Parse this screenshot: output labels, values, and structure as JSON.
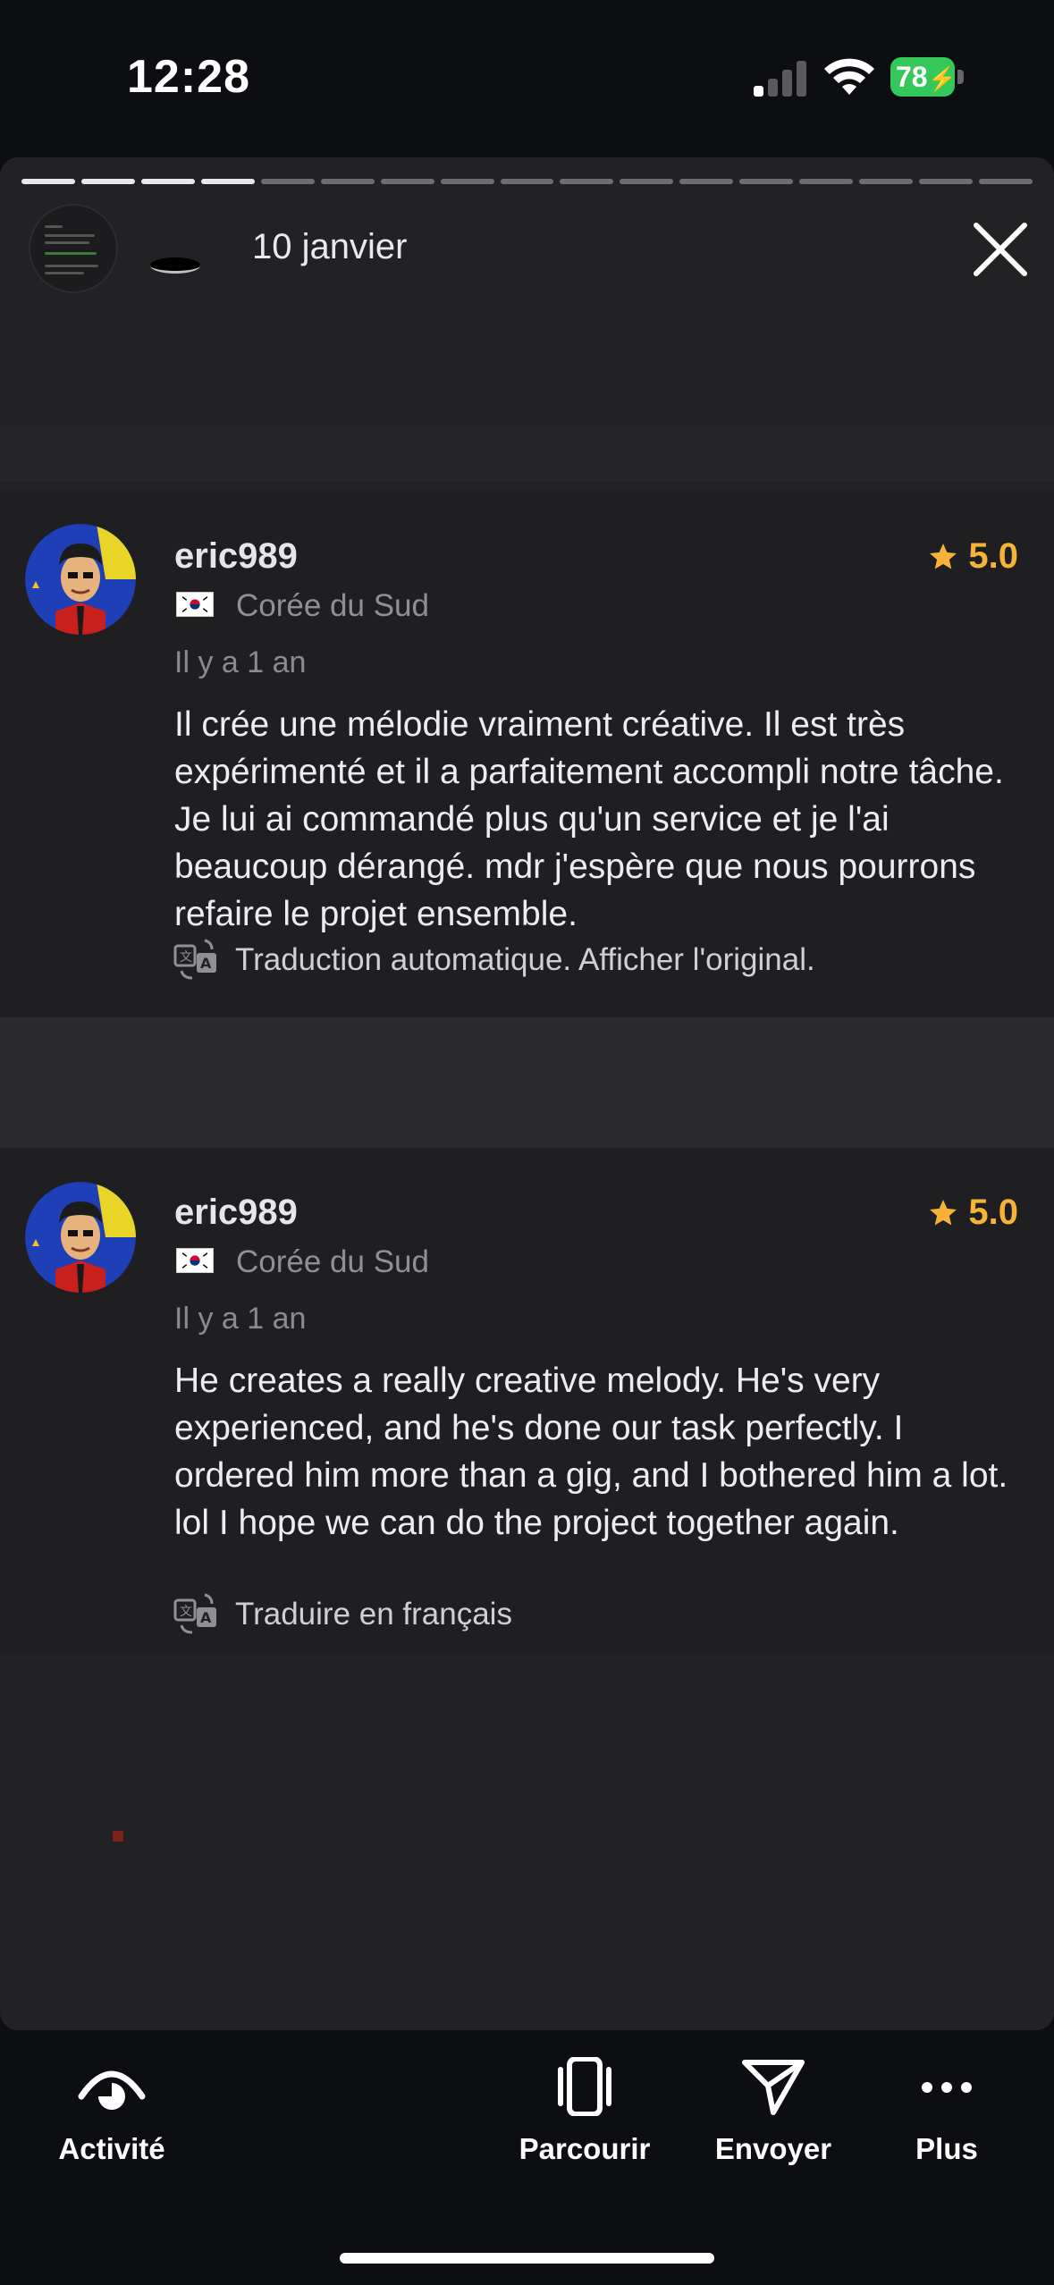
{
  "status": {
    "time": "12:28",
    "battery": "78",
    "battery_color": "#34c759"
  },
  "story": {
    "date": "10 janvier",
    "segments_total": 17,
    "segments_done": 4
  },
  "reviews": [
    {
      "username": "eric989",
      "rating": "5.0",
      "country": "Corée du Sud",
      "ago": "Il y a 1 an",
      "text": "Il crée une mélodie vraiment créative. Il est très expérimenté et il a parfaitement accompli notre tâche. Je lui ai commandé plus qu'un service et je l'ai beaucoup dérangé. mdr j'espère que nous pourrons refaire le projet ensemble.",
      "translate_label": "Traduction automatique. Afficher l'original."
    },
    {
      "username": "eric989",
      "rating": "5.0",
      "country": "Corée du Sud",
      "ago": "Il y a 1 an",
      "text": "He creates a really creative melody. He's very experienced, and he's done our task perfectly. I ordered him more than a gig, and I bothered him a lot. lol I hope we can do the project together again.",
      "translate_label": "Traduire en français"
    }
  ],
  "bottom_bar": {
    "activity": "Activité",
    "browse": "Parcourir",
    "send": "Envoyer",
    "more": "Plus"
  },
  "colors": {
    "rating": "#f7b338",
    "background": "#0d0e12",
    "panel": "#222224"
  }
}
